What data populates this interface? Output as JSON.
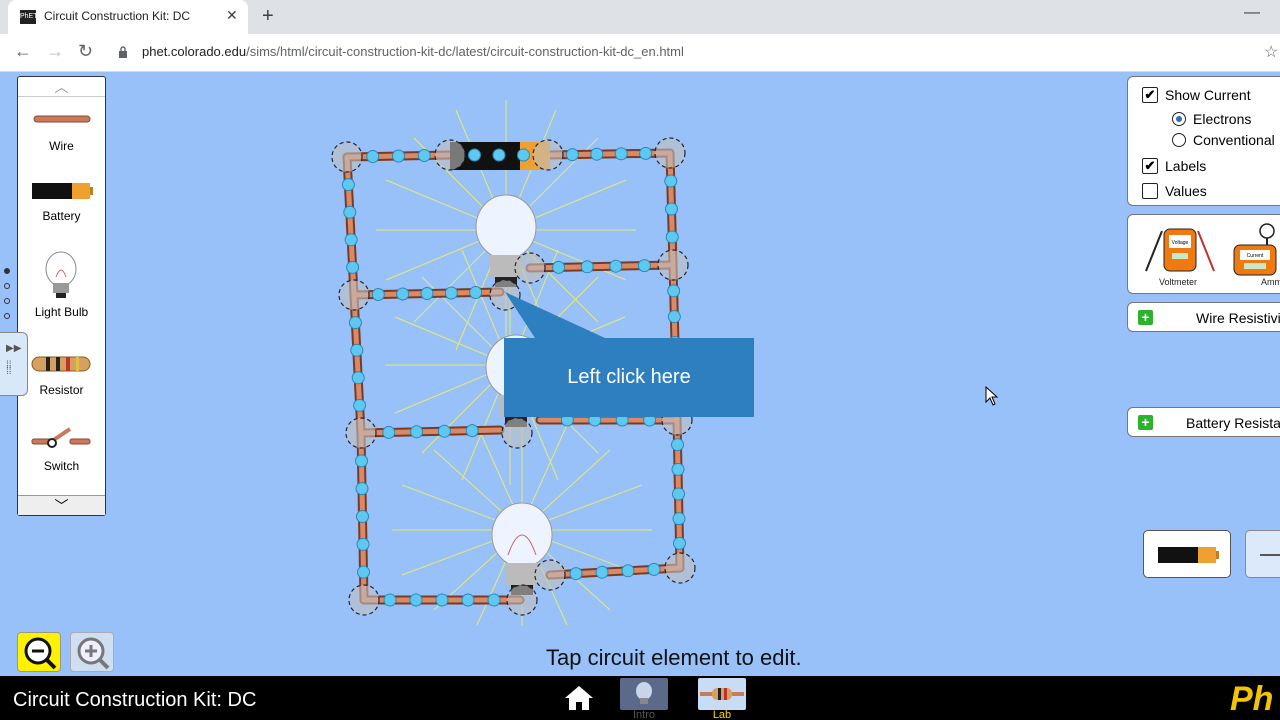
{
  "browser": {
    "tab_title": "Circuit Construction Kit: DC",
    "favicon_text": "PhET",
    "url_host": "phet.colorado.edu",
    "url_path": "/sims/html/circuit-construction-kit-dc/latest/circuit-construction-kit-dc_en.html"
  },
  "toolbox": {
    "items": [
      {
        "label": "Wire"
      },
      {
        "label": "Battery"
      },
      {
        "label": "Light Bulb"
      },
      {
        "label": "Resistor"
      },
      {
        "label": "Switch"
      }
    ]
  },
  "tooltip": {
    "text": "Left click here"
  },
  "control_panel": {
    "show_current": {
      "label": "Show Current",
      "checked": true
    },
    "electrons": {
      "label": "Electrons",
      "selected": true
    },
    "conventional": {
      "label": "Conventional",
      "selected": false
    },
    "labels": {
      "label": "Labels",
      "checked": true
    },
    "values": {
      "label": "Values",
      "checked": false
    }
  },
  "meters": {
    "voltmeter": "Voltmeter",
    "ammeter": "Amm",
    "voltmeter_face": "Voltage",
    "ammeter_face": "Current"
  },
  "accordions": {
    "wire_resistivity": "Wire Resistivi",
    "battery_resistance": "Battery Resistar"
  },
  "status": {
    "message": "Tap circuit element to edit."
  },
  "footer": {
    "sim_title": "Circuit Construction Kit: DC",
    "screens": [
      "Intro",
      "Lab"
    ],
    "logo": "Ph"
  },
  "colors": {
    "background": "#99c1f9",
    "wire": "#c87a5a",
    "electron": "#5ec8f0",
    "tooltip": "#2e7fc0",
    "zoom_active": "#fff200"
  }
}
